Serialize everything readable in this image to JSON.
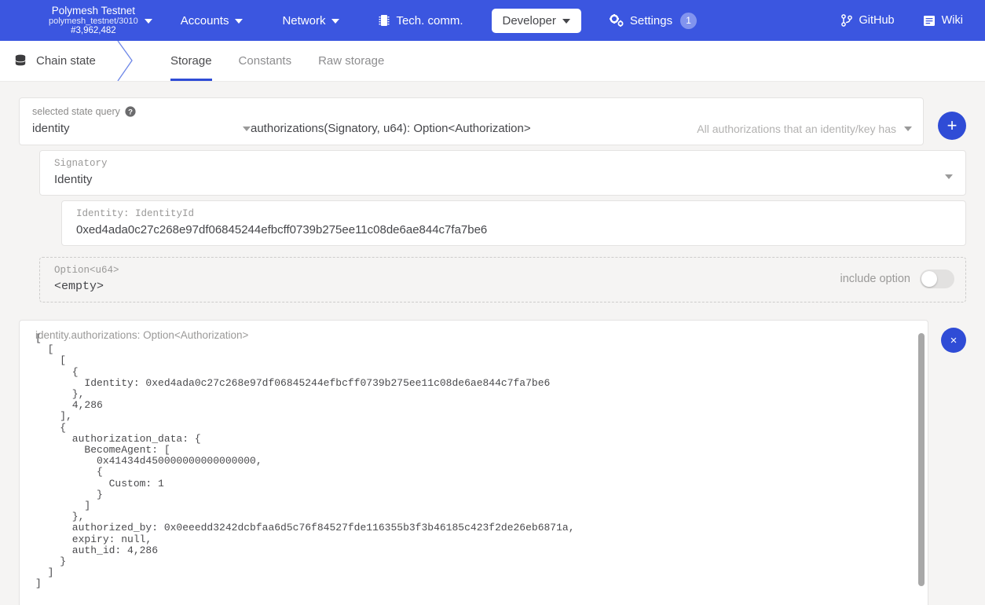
{
  "header": {
    "chain": {
      "name": "Polymesh Testnet",
      "spec": "polymesh_testnet/3010",
      "block": "#3,962,482"
    },
    "nav": [
      {
        "label": "Accounts",
        "icon": "chevron-down-icon",
        "active": false
      },
      {
        "label": "Network",
        "icon": "chevron-down-icon",
        "active": false
      },
      {
        "label": "Tech. comm.",
        "icon": "memory-chip-icon",
        "active": false
      },
      {
        "label": "Developer",
        "icon": "chevron-down-icon",
        "active": true
      },
      {
        "label": "Settings",
        "icon": "gears-icon",
        "active": false,
        "badge": "1"
      }
    ],
    "links": [
      {
        "label": "GitHub",
        "icon": "git-branch-icon"
      },
      {
        "label": "Wiki",
        "icon": "book-icon"
      }
    ]
  },
  "subnav": {
    "breadcrumb": "Chain state",
    "breadcrumb_icon": "database-icon",
    "tabs": [
      {
        "label": "Storage",
        "active": true
      },
      {
        "label": "Constants",
        "active": false
      },
      {
        "label": "Raw storage",
        "active": false
      }
    ]
  },
  "query": {
    "label": "selected state query",
    "help_icon": "question-circle-icon",
    "module": "identity",
    "method": "authorizations(Signatory, u64): Option<Authorization>",
    "method_hint": "All authorizations that an identity/key has",
    "add_button": "+"
  },
  "params": {
    "signatory": {
      "label": "Signatory",
      "value": "Identity"
    },
    "identity": {
      "label": "Identity: IdentityId",
      "value": "0xed4ada0c27c268e97df06845244efbcff0739b275ee11c08de6ae844c7fa7be6"
    },
    "option": {
      "label": "Option<u64>",
      "value": "<empty>",
      "toggle_label": "include option",
      "toggle_on": false
    }
  },
  "result": {
    "heading": "identity.authorizations: Option<Authorization>",
    "close_button": "×",
    "json": "[\n  [\n    [\n      {\n        Identity: 0xed4ada0c27c268e97df06845244efbcff0739b275ee11c08de6ae844c7fa7be6\n      },\n      4,286\n    ],\n    {\n      authorization_data: {\n        BecomeAgent: [\n          0x41434d450000000000000000,\n          {\n            Custom: 1\n          }\n        ]\n      },\n      authorized_by: 0x0eeedd3242dcbfaa6d5c76f84527fde116355b3f3b46185c423f2de26eb6871a,\n      expiry: null,\n      auth_id: 4,286\n    }\n  ]\n]"
  }
}
